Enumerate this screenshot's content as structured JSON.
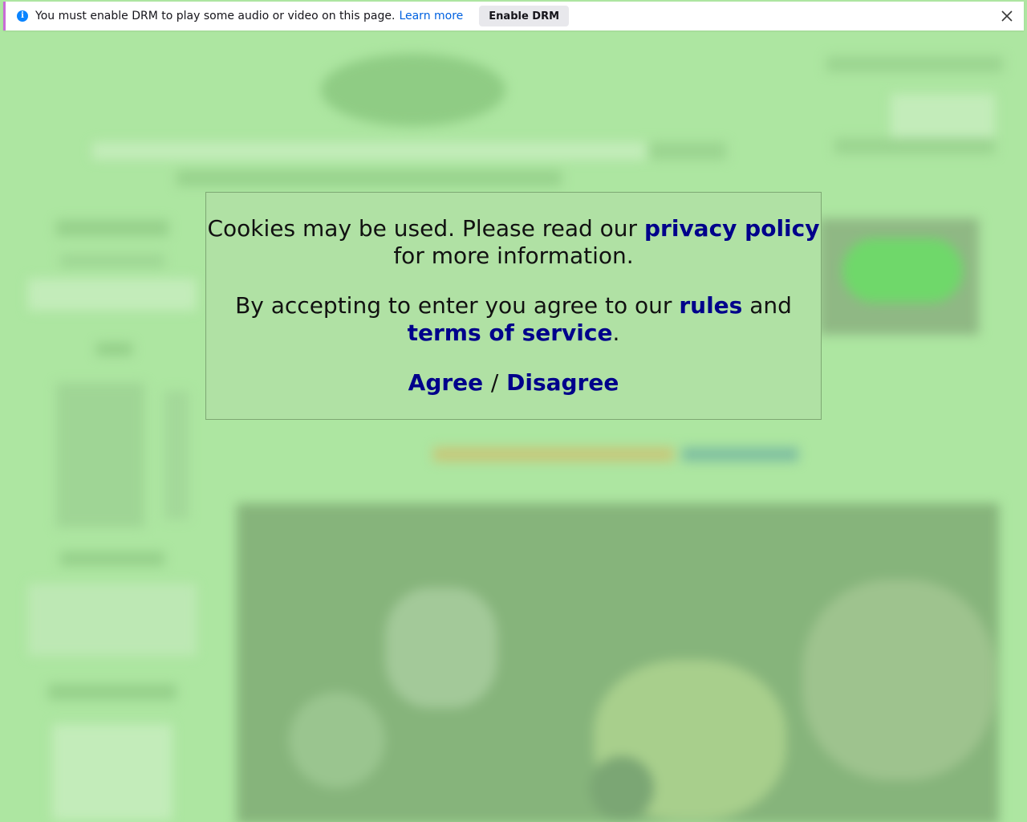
{
  "drm_bar": {
    "message": "You must enable DRM to play some audio or video on this page.",
    "learn_more": "Learn more",
    "enable_button": "Enable DRM",
    "info_icon": "info-icon",
    "close_icon": "close-icon"
  },
  "cookie_modal": {
    "line1_prefix": "Cookies may be used. Please read our",
    "privacy_link": "privacy policy",
    "line1_suffix": "for more information.",
    "line2_prefix": "By accepting to enter you agree to our",
    "rules_link": "rules",
    "and": "and",
    "tos_link": "terms of service",
    "period": ".",
    "agree": "Agree",
    "separator": "/",
    "disagree": "Disagree"
  },
  "colors": {
    "page_background": "#ade6a1",
    "link_color": "#00008b",
    "drm_link_color": "#0061e0",
    "info_icon_color": "#0a84ff"
  }
}
